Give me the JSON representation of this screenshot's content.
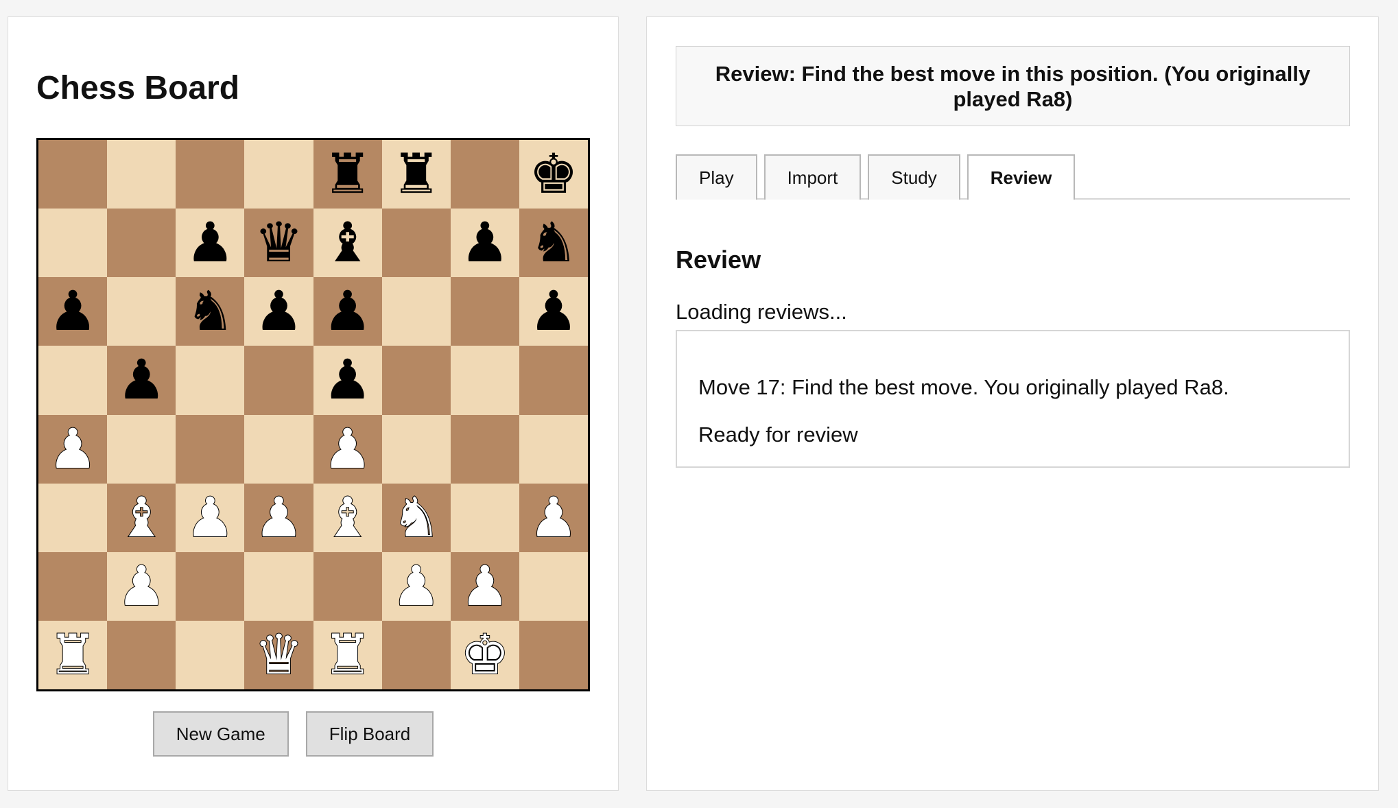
{
  "left": {
    "title": "Chess Board",
    "board": [
      [
        "",
        "",
        "",
        "",
        "r",
        "r",
        "",
        "k"
      ],
      [
        "",
        "",
        "p",
        "q",
        "b",
        "",
        "p",
        "n"
      ],
      [
        "p",
        "",
        "n",
        "p",
        "p",
        "",
        "",
        "p"
      ],
      [
        "",
        "p",
        "",
        "",
        "p",
        "",
        "",
        ""
      ],
      [
        "P",
        "",
        "",
        "",
        "P",
        "",
        "",
        ""
      ],
      [
        "",
        "B",
        "P",
        "P",
        "B",
        "N",
        "",
        "P"
      ],
      [
        "",
        "P",
        "",
        "",
        "",
        "P",
        "P",
        ""
      ],
      [
        "R",
        "",
        "",
        "Q",
        "R",
        "",
        "K",
        ""
      ]
    ],
    "colors": {
      "light": "#f0d9b5",
      "dark": "#b58863"
    },
    "new_game_label": "New Game",
    "flip_board_label": "Flip Board"
  },
  "right": {
    "banner": "Review: Find the best move in this position. (You originally played Ra8)",
    "tabs": [
      {
        "label": "Play",
        "active": false
      },
      {
        "label": "Import",
        "active": false
      },
      {
        "label": "Study",
        "active": false
      },
      {
        "label": "Review",
        "active": true
      }
    ],
    "section_title": "Review",
    "loading_text": "Loading reviews...",
    "review": {
      "line1": "Move 17: Find the best move. You originally played Ra8.",
      "line2": "Ready for review"
    }
  }
}
